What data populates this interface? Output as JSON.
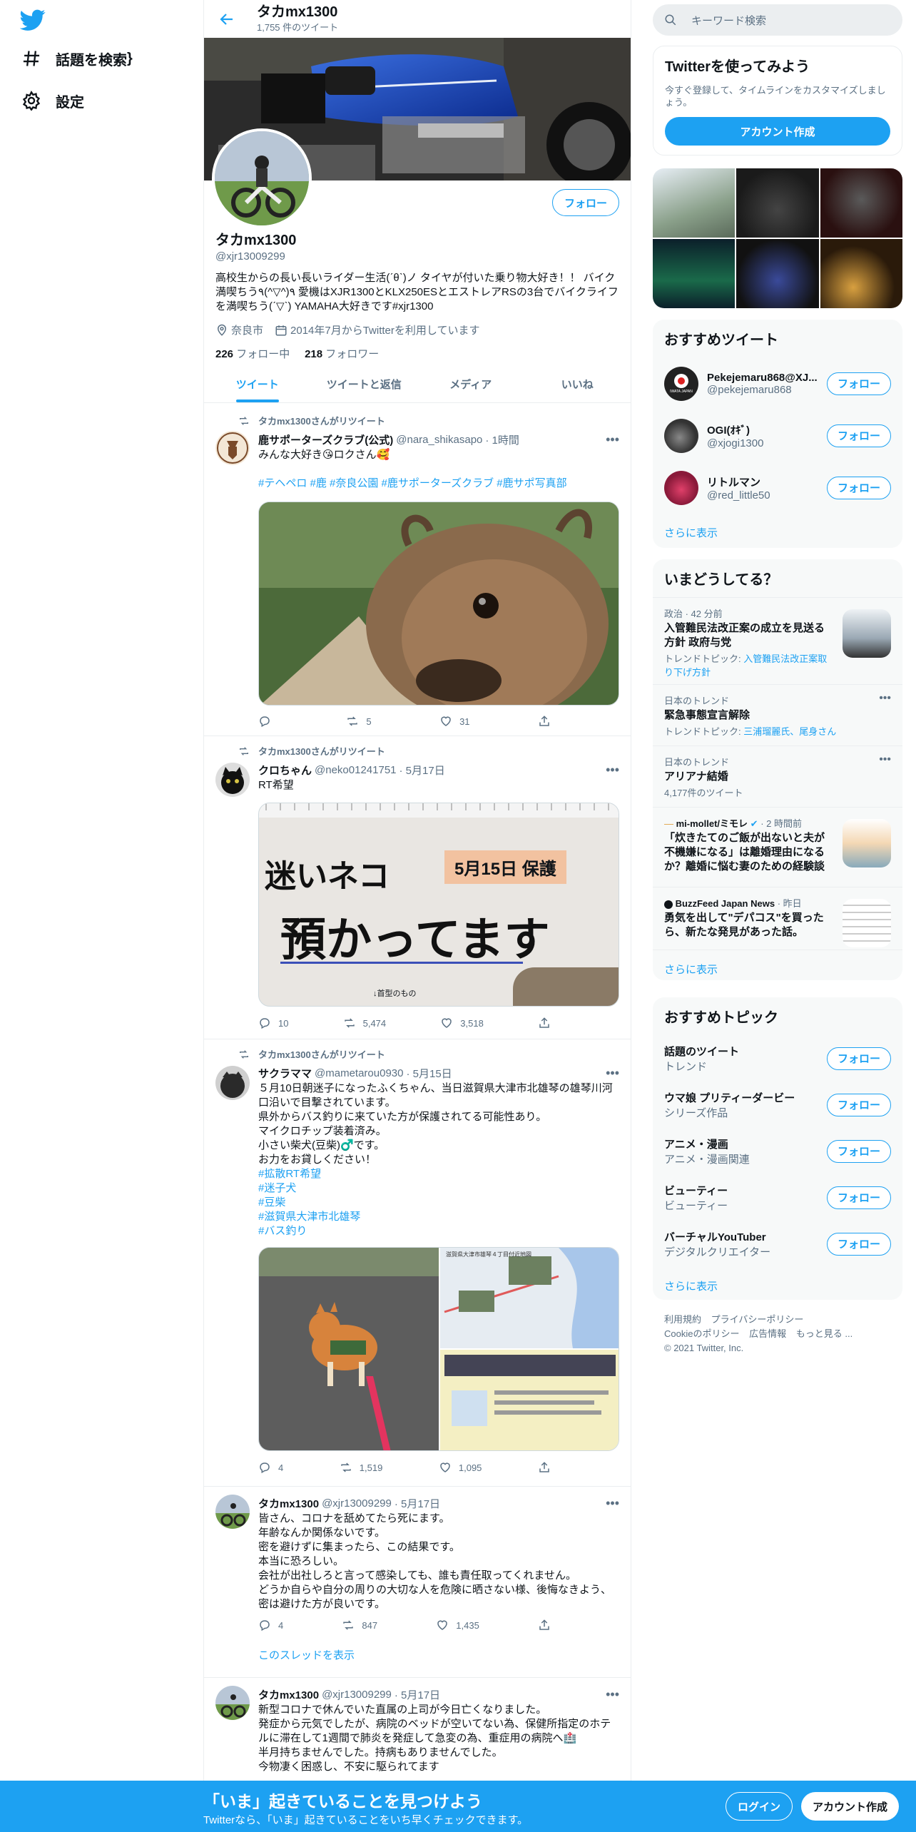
{
  "nav": {
    "explore": "話題を検索",
    "settings": "設定"
  },
  "header": {
    "title": "タカmx1300",
    "tweet_count": "1,755 件のツイート"
  },
  "profile": {
    "follow": "フォロー",
    "name": "タカmx1300",
    "handle": "@xjr13009299",
    "bio": "高校生からの長い長いライダー生活(ˊθˋ)ノ タイヤが付いた乗り物大好き！！ バイク満喫ちう٩(^▽^)٩ 愛機はXJR1300とKLX250ESとエストレアRSの3台でバイクライフを満喫ちう(ˊ▽ˋ) YAMAHA大好きです#xjr1300",
    "location": "奈良市",
    "joined": "2014年7月からTwitterを利用しています",
    "following_count": "226",
    "following_label": "フォロー中",
    "followers_count": "218",
    "followers_label": "フォロワー"
  },
  "tabs": [
    "ツイート",
    "ツイートと返信",
    "メディア",
    "いいね"
  ],
  "tweets": [
    {
      "rt": "タカmx1300さんがリツイート",
      "name": "鹿サポーターズクラブ(公式)",
      "handle": "@nara_shikasapo",
      "time": "· 1時間",
      "text": "みんな大好き😘ロクさん🥰",
      "tags": "#テヘペロ #鹿 #奈良公園 #鹿サポーターズクラブ #鹿サポ写真部",
      "reply": "",
      "retweet": "5",
      "like": "31"
    },
    {
      "rt": "タカmx1300さんがリツイート",
      "name": "クロちゃん",
      "handle": "@neko01241751",
      "time": "· 5月17日",
      "text": "RT希望",
      "img_title": "迷いネコ",
      "img_date": "5月15日 保護",
      "img_main": "預かってます",
      "img_small": "↓首型のもの",
      "reply": "10",
      "retweet": "5,474",
      "like": "3,518"
    },
    {
      "rt": "タカmx1300さんがリツイート",
      "name": "サクラママ",
      "handle": "@mametarou0930",
      "time": "· 5月15日",
      "text": "５月10日朝迷子になったふくちゃん、当日滋賀県大津市北雄琴の雄琴川河口沿いで目撃されています。\n県外からバス釣りに来ていた方が保護されてる可能性あり。\nマイクロチップ装着済み。\n小さい柴犬(豆柴)♂️です。\nお力をお貸しください！",
      "tags": "#拡散RT希望\n#迷子犬\n#豆柴\n#滋賀県大津市北雄琴\n#バス釣り",
      "map_label": "滋賀県大津市雄琴４丁目付近地図",
      "reply": "4",
      "retweet": "1,519",
      "like": "1,095"
    },
    {
      "name": "タカmx1300",
      "handle": "@xjr13009299",
      "time": "· 5月17日",
      "text": "皆さん、コロナを舐めてたら死にます。\n年齢なんか関係ないです。\n密を避けずに集まったら、この結果です。\n本当に恐ろしい。\n会社が出社しろと言って感染しても、誰も責任取ってくれません。\nどうか自らや自分の周りの大切な人を危険に晒さない様、後悔なきよう、密は避けた方が良いです。",
      "reply": "4",
      "retweet": "847",
      "like": "1,435",
      "thread": "このスレッドを表示"
    },
    {
      "name": "タカmx1300",
      "handle": "@xjr13009299",
      "time": "· 5月17日",
      "text": "新型コロナで休んでいた直属の上司が今日亡くなりました。\n発症から元気でしたが、病院のベッドが空いてない為、保健所指定のホテルに滞在して1週間で肺炎を発症して急変の為、重症用の病院へ🏥\n半月持ちませんでした。持病もありませんでした。\n今物凄く困惑し、不安に駆られてます"
    }
  ],
  "right": {
    "search_placeholder": "キーワード検索",
    "signup_title": "Twitterを使ってみよう",
    "signup_text": "今すぐ登録して、タイムラインをカスタマイズしましょう。",
    "signup_button": "アカウント作成",
    "rec_title": "おすすめツイート",
    "rec_users": [
      {
        "name": "Pekejemaru868@XJ...",
        "handle": "@pekejemaru868",
        "btn": "フォロー",
        "avatar_text": "IWATA JAPAN"
      },
      {
        "name": "OGI(ｵｷﾞ)",
        "handle": "@xjogi1300",
        "btn": "フォロー"
      },
      {
        "name": "リトルマン",
        "handle": "@red_little50",
        "btn": "フォロー"
      }
    ],
    "show_more": "さらに表示",
    "trends_title": "いまどうしてる？",
    "trends": [
      {
        "meta": "政治 · 42 分前",
        "title": "入管難民法改正案の成立を見送る方針 政府与党",
        "sub_prefix": "トレンドトピック: ",
        "sub_link": "入管難民法改正案取り下げ方針"
      },
      {
        "meta": "日本のトレンド",
        "title": "緊急事態宣言解除",
        "sub_prefix": "トレンドトピック: ",
        "sub_link": "三浦瑠麗氏、尾身さん"
      },
      {
        "meta": "日本のトレンド",
        "title": "アリアナ結婚",
        "sub": "4,177件のツイート"
      },
      {
        "meta": "mi-mollet/ミモレ",
        "meta2": "· 2 時間前",
        "title": "「炊きたてのご飯が出ないと夫が不機嫌になる」は離婚理由になるか？離婚に悩む妻のための経験談"
      },
      {
        "meta": "BuzzFeed Japan News",
        "meta2": "· 昨日",
        "title": "勇気を出して\"デパコス\"を買ったら、新たな発見があった話。"
      }
    ],
    "topics_title": "おすすめトピック",
    "topics": [
      {
        "name": "話題のツイート",
        "sub": "トレンド",
        "btn": "フォロー"
      },
      {
        "name": "ウマ娘 プリティーダービー",
        "sub": "シリーズ作品",
        "btn": "フォロー"
      },
      {
        "name": "アニメ・漫画",
        "sub": "アニメ・漫画関連",
        "btn": "フォロー"
      },
      {
        "name": "ビューティー",
        "sub": "ビューティー",
        "btn": "フォロー"
      },
      {
        "name": "バーチャルYouTuber",
        "sub": "デジタルクリエイター",
        "btn": "フォロー"
      }
    ],
    "footer": {
      "terms": "利用規約",
      "privacy": "プライバシーポリシー",
      "cookie": "Cookieのポリシー",
      "ads": "広告情報",
      "more": "もっと見る ...",
      "copyright": "© 2021 Twitter, Inc."
    }
  },
  "bottombar": {
    "title": "「いま」起きていることを見つけよう",
    "sub": "Twitterなら、「いま」起きていることをいち早くチェックできます。",
    "login": "ログイン",
    "signup": "アカウント作成"
  },
  "colors": {
    "accent": "#1da1f2",
    "text": "#0f1419",
    "muted": "#5b7083"
  }
}
